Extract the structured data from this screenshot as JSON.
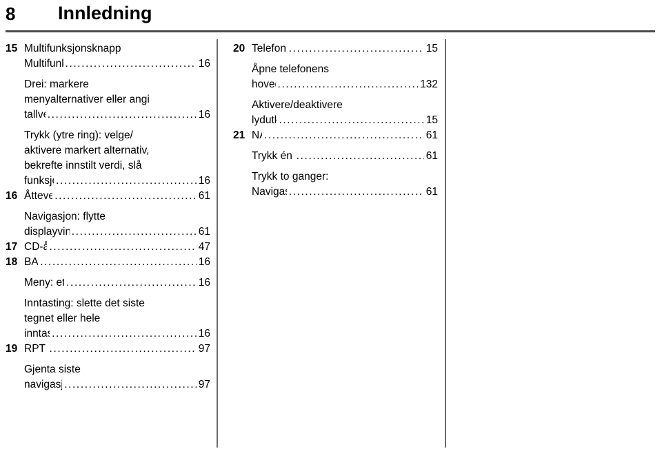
{
  "header": {
    "page_number": "8",
    "chapter_title": "Innledning"
  },
  "colors": {
    "text": "#000000",
    "rule": "#4a4a4a",
    "divider": "#6b6b6b",
    "background": "#ffffff"
  },
  "columns": {
    "left": [
      {
        "num": "15",
        "lines": [
          "Multifunksjonsknapp"
        ],
        "last_line": "Multifunksjonsknapp",
        "page": "16",
        "bold_num": true,
        "spaced": false
      },
      {
        "num": "",
        "lines": [
          "Drei: markere",
          "menyalternativer eller angi"
        ],
        "last_line": "tallverdier",
        "page": "16",
        "bold_num": false,
        "spaced": true
      },
      {
        "num": "",
        "lines": [
          "Trykk (ytre ring): velge/",
          "aktivere markert alternativ,",
          "bekrefte innstilt verdi, slå"
        ],
        "last_line": "funksjon på/av",
        "page": "16",
        "bold_num": false,
        "spaced": true
      },
      {
        "num": "16",
        "lines": [],
        "last_line": "Åtteveisbryter",
        "page": "61",
        "bold_num": true,
        "spaced": false
      },
      {
        "num": "",
        "lines": [
          "Navigasjon: flytte"
        ],
        "last_line": "displayvindu i kartvisning",
        "page": "61",
        "bold_num": false,
        "spaced": true
      },
      {
        "num": "17",
        "lines": [],
        "last_line": "CD-åpning",
        "page": "47",
        "bold_num": true,
        "spaced": false
      },
      {
        "num": "18",
        "lines": [],
        "last_line": "BACK",
        "page": "16",
        "bold_num": true,
        "spaced": false
      },
      {
        "num": "",
        "lines": [],
        "last_line": "Meny: ett nivå tilbake",
        "page": "16",
        "bold_num": false,
        "spaced": true
      },
      {
        "num": "",
        "lines": [
          "Inntasting: slette det siste",
          "tegnet eller hele"
        ],
        "last_line": "inntastingen",
        "page": "16",
        "bold_num": false,
        "spaced": true
      },
      {
        "num": "19",
        "lines": [],
        "last_line": "RPT / NAV",
        "page": "97",
        "bold_num": true,
        "spaced": false
      },
      {
        "num": "",
        "lines": [
          "Gjenta siste"
        ],
        "last_line": "navigasjonsmelding",
        "page": "97",
        "bold_num": false,
        "spaced": true
      }
    ],
    "right": [
      {
        "num": "20",
        "lines": [],
        "last_line": "Telefon / demping",
        "page": "15",
        "bold_num": true,
        "spaced": false
      },
      {
        "num": "",
        "lines": [
          "Åpne telefonens"
        ],
        "last_line": "hovedmeny",
        "page": "132",
        "bold_num": false,
        "spaced": true
      },
      {
        "num": "",
        "lines": [
          "Aktivere/deaktivere"
        ],
        "last_line": "lydutkobling",
        "page": "15",
        "bold_num": false,
        "spaced": true
      },
      {
        "num": "21",
        "lines": [],
        "last_line": "NAV",
        "page": "61",
        "bold_num": true,
        "spaced": false
      },
      {
        "num": "",
        "lines": [],
        "last_line": "Trykk én gang: Vis kart",
        "page": "61",
        "bold_num": false,
        "spaced": true
      },
      {
        "num": "",
        "lines": [
          "Trykk to ganger:"
        ],
        "last_line": "Navigasjonsmeny",
        "page": "61",
        "bold_num": false,
        "spaced": true
      }
    ]
  }
}
